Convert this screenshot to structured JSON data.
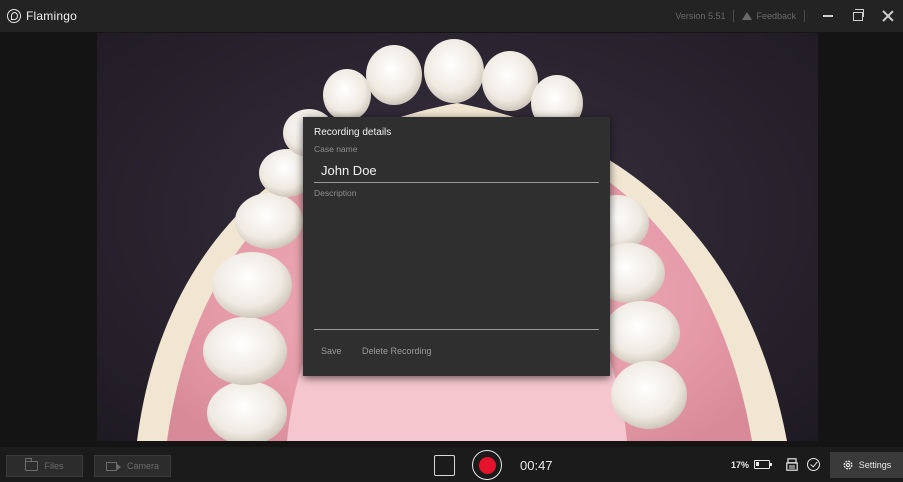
{
  "window": {
    "title": "Flamingo",
    "version": "Version 5.51",
    "feedback_label": "Feedback"
  },
  "dialog": {
    "title": "Recording details",
    "case_name_label": "Case name",
    "case_name_value": "John Doe",
    "description_label": "Description",
    "description_value": "",
    "save_label": "Save",
    "delete_label": "Delete Recording"
  },
  "toolbar": {
    "files_label": "Files",
    "camera_label": "Camera",
    "timer": "00:47",
    "battery_percent": "17%",
    "settings_label": "Settings"
  },
  "colors": {
    "record": "#e5132b",
    "dialog_bg": "#2f2f2f",
    "bar_bg": "#1b1b1b"
  }
}
